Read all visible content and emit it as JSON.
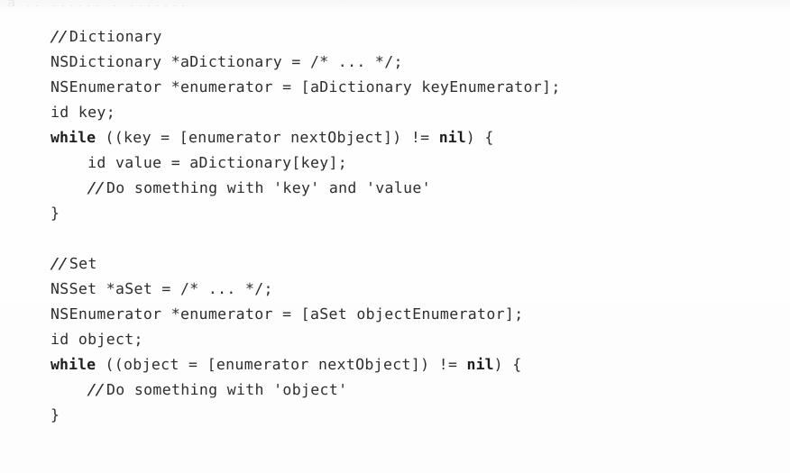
{
  "page": {
    "kind": "scanned-book-code-listing",
    "language": "Objective-C",
    "background_color": "#fdfdfd",
    "text_color": "#2e2e30",
    "top_artifact_text": "a  ..  ......  .  ......."
  },
  "code": {
    "lines": [
      {
        "id": "l1",
        "indent": 0,
        "type": "comment",
        "slashes": "//",
        "text": "Dictionary"
      },
      {
        "id": "l2",
        "indent": 0,
        "type": "code",
        "text": "NSDictionary *aDictionary = /* ... */;"
      },
      {
        "id": "l3",
        "indent": 0,
        "type": "code",
        "text": "NSEnumerator *enumerator = [aDictionary keyEnumerator];"
      },
      {
        "id": "l4",
        "indent": 0,
        "type": "code",
        "text": "id key;"
      },
      {
        "id": "l5",
        "indent": 0,
        "type": "code-kw",
        "kw_lead": "while",
        "mid": " ((key = [enumerator nextObject]) != ",
        "kw_tail": "nil",
        "tail": ") {"
      },
      {
        "id": "l6",
        "indent": 1,
        "type": "code",
        "text": "    id value = aDictionary[key];"
      },
      {
        "id": "l7",
        "indent": 1,
        "type": "comment",
        "slashes": "//",
        "text": "Do something with 'key' and 'value'",
        "lead": "    "
      },
      {
        "id": "l8",
        "indent": 0,
        "type": "code",
        "text": "}"
      },
      {
        "id": "l9",
        "indent": 0,
        "type": "blank",
        "text": ""
      },
      {
        "id": "l10",
        "indent": 0,
        "type": "comment",
        "slashes": "//",
        "text": "Set"
      },
      {
        "id": "l11",
        "indent": 0,
        "type": "code",
        "text": "NSSet *aSet = /* ... */;"
      },
      {
        "id": "l12",
        "indent": 0,
        "type": "code",
        "text": "NSEnumerator *enumerator = [aSet objectEnumerator];"
      },
      {
        "id": "l13",
        "indent": 0,
        "type": "code",
        "text": "id object;"
      },
      {
        "id": "l14",
        "indent": 0,
        "type": "code-kw",
        "kw_lead": "while",
        "mid": " ((object = [enumerator nextObject]) != ",
        "kw_tail": "nil",
        "tail": ") {"
      },
      {
        "id": "l15",
        "indent": 1,
        "type": "comment",
        "slashes": "//",
        "text": "Do something with 'object'",
        "lead": "    "
      },
      {
        "id": "l16",
        "indent": 0,
        "type": "code",
        "text": "}"
      }
    ]
  }
}
